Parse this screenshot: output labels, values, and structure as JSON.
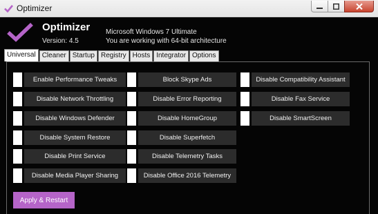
{
  "window": {
    "title": "Optimizer",
    "controls": [
      "minimize",
      "maximize",
      "close"
    ]
  },
  "header": {
    "app_name": "Optimizer",
    "version": "Version: 4.5",
    "os_name": "Microsoft Windows 7 Ultimate",
    "arch_text": "You are working with 64-bit architecture",
    "accent_color": "#b564c8"
  },
  "tabs": [
    {
      "label": "Universal",
      "active": true
    },
    {
      "label": "Cleaner",
      "active": false
    },
    {
      "label": "Startup",
      "active": false
    },
    {
      "label": "Registry",
      "active": false
    },
    {
      "label": "Hosts",
      "active": false
    },
    {
      "label": "Integrator",
      "active": false
    },
    {
      "label": "Options",
      "active": false
    }
  ],
  "tweaks": {
    "col1": [
      "Enable Performance Tweaks",
      "Disable Network Throttling",
      "Disable Windows Defender",
      "Disable System Restore",
      "Disable Print Service",
      "Disable Media Player Sharing"
    ],
    "col2": [
      "Block Skype Ads",
      "Disable Error Reporting",
      "Disable HomeGroup",
      "Disable Superfetch",
      "Disable Telemetry Tasks",
      "Disable Office 2016 Telemetry"
    ],
    "col3": [
      "Disable Compatibility Assistant",
      "Disable Fax Service",
      "Disable SmartScreen"
    ]
  },
  "apply_button": "Apply & Restart"
}
